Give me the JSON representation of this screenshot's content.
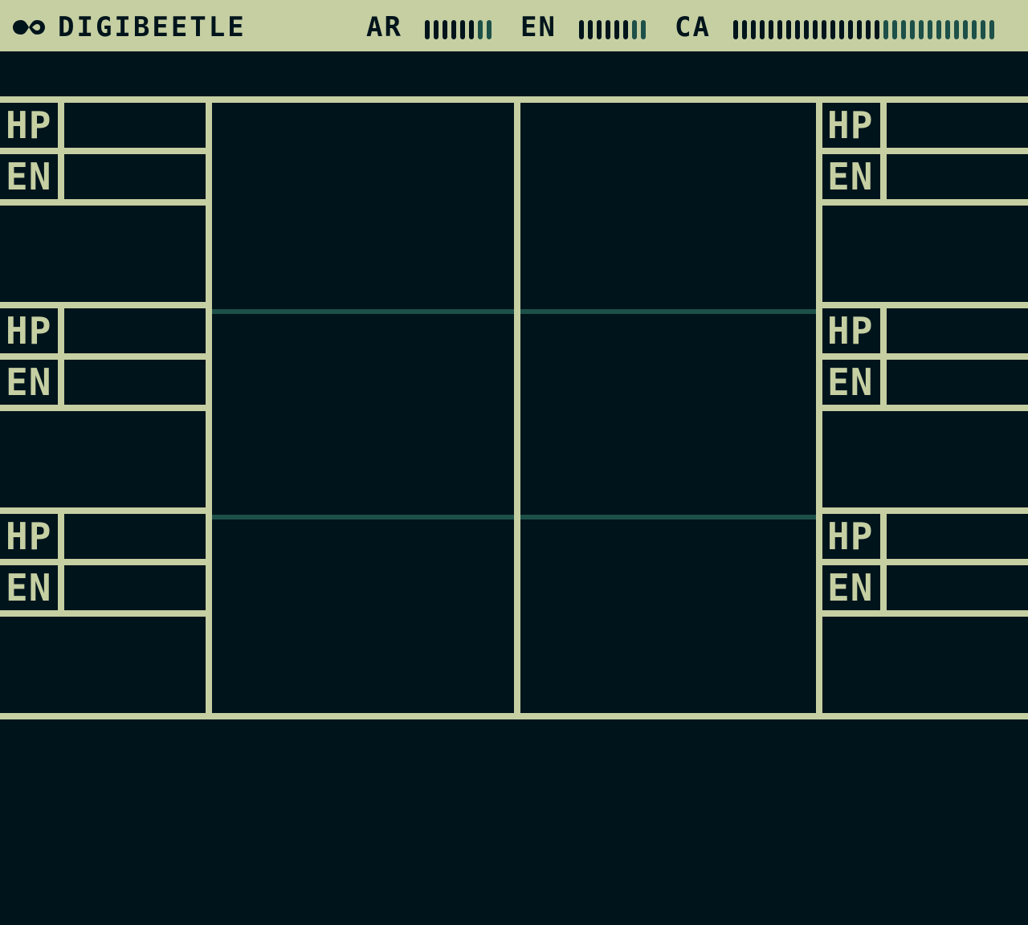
{
  "app": {
    "title": "DIGIBEETLE",
    "logo_icon": "infinity-icon"
  },
  "stats": [
    {
      "id": "ar",
      "label": "AR",
      "segments_total": 8,
      "segments_filled": 6
    },
    {
      "id": "en",
      "label": "EN",
      "segments_total": 8,
      "segments_filled": 6
    },
    {
      "id": "ca",
      "label": "CA",
      "segments_total": 30,
      "segments_filled": 17
    }
  ],
  "colors": {
    "background": "#00141c",
    "frame": "#c5cfa2",
    "filled_tick": "#00141c",
    "empty_tick": "#1d5048",
    "divider": "#1d5048"
  },
  "left_units": [
    {
      "hp_label": "HP",
      "en_label": "EN"
    },
    {
      "hp_label": "HP",
      "en_label": "EN"
    },
    {
      "hp_label": "HP",
      "en_label": "EN"
    }
  ],
  "right_units": [
    {
      "hp_label": "HP",
      "en_label": "EN"
    },
    {
      "hp_label": "HP",
      "en_label": "EN"
    },
    {
      "hp_label": "HP",
      "en_label": "EN"
    }
  ]
}
